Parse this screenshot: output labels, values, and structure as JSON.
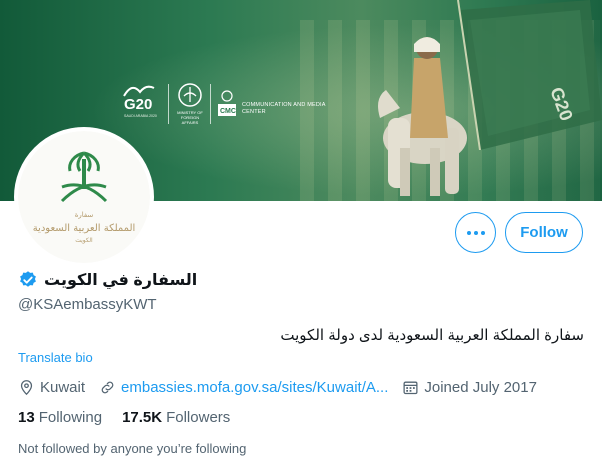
{
  "banner": {
    "logos": {
      "g20": "G20",
      "g20_sub": "SAUDI ARABIA 2020",
      "mofa": "MINISTRY OF FOREIGN AFFAIRS",
      "cmc_label": "CMC",
      "cmc_text": "COMMUNICATION AND MEDIA CENTER"
    },
    "flag_text": "G20"
  },
  "avatar": {
    "emblem": "saudi-emblem-icon",
    "line1": "سفارة",
    "line2": "المملكة العربية السعودية",
    "line3": "الكويت"
  },
  "actions": {
    "more_icon": "more-dots-icon",
    "follow_label": "Follow"
  },
  "profile": {
    "display_name": "السفارة في الكويت",
    "verified_icon": "verified-badge-icon",
    "handle": "@KSAembassyKWT",
    "bio": "سفارة المملكة العربية السعودية لدى دولة الكويت",
    "translate_label": "Translate bio"
  },
  "meta": {
    "location_icon": "location-pin-icon",
    "location": "Kuwait",
    "link_icon": "link-icon",
    "link_text": "embassies.mofa.gov.sa/sites/Kuwait/A...",
    "calendar_icon": "calendar-icon",
    "joined": "Joined July 2017"
  },
  "stats": {
    "following_count": "13",
    "following_label": "Following",
    "followers_count": "17.5K",
    "followers_label": "Followers"
  },
  "social_context": "Not followed by anyone you’re following",
  "colors": {
    "accent": "#1d9bf0",
    "banner_green": "#2a7a4f",
    "text_primary": "#0f1419",
    "text_secondary": "#536471"
  }
}
